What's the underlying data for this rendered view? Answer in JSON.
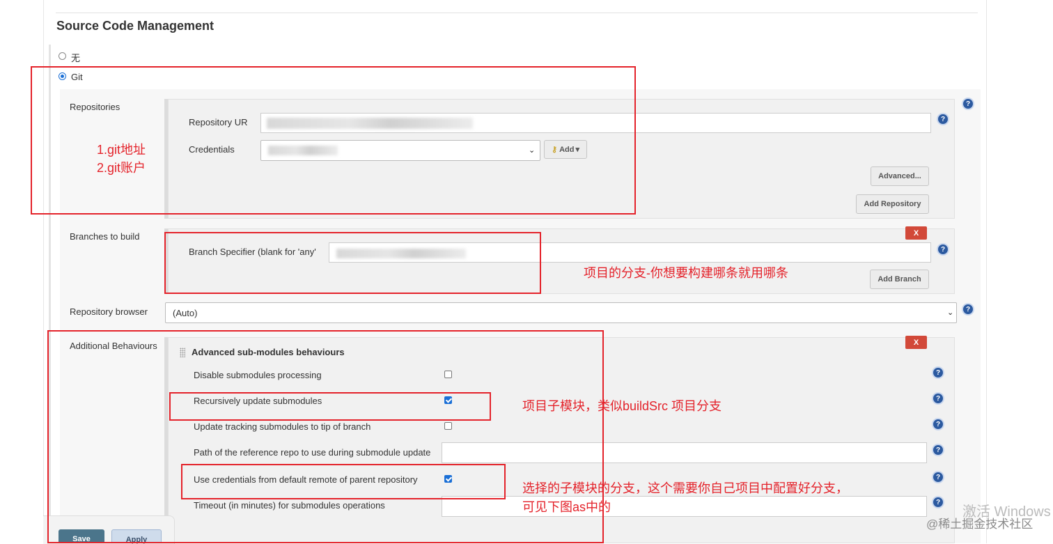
{
  "section": {
    "title": "Source Code Management"
  },
  "scm": {
    "none_label": "无",
    "git_label": "Git",
    "selected": "Git"
  },
  "repositories": {
    "label": "Repositories",
    "repo_url_label": "Repository UR",
    "credentials_label": "Credentials",
    "add_label": "Add",
    "advanced_label": "Advanced...",
    "add_repository_label": "Add Repository"
  },
  "branches": {
    "label": "Branches to build",
    "specifier_label": "Branch Specifier (blank for 'any'",
    "add_branch_label": "Add Branch",
    "delete_label": "X"
  },
  "browser": {
    "label": "Repository browser",
    "value": "(Auto)"
  },
  "behaviours": {
    "label": "Additional Behaviours",
    "group_title": "Advanced sub-modules behaviours",
    "delete_label": "X",
    "items": [
      {
        "label": "Disable submodules processing",
        "checked": false
      },
      {
        "label": "Recursively update submodules",
        "checked": true
      },
      {
        "label": "Update tracking submodules to tip of branch",
        "checked": false
      },
      {
        "label": "Path of the reference repo to use during submodule update"
      },
      {
        "label": "Use credentials from default remote of parent repository",
        "checked": true
      },
      {
        "label": "Timeout (in minutes) for submodules operations"
      }
    ]
  },
  "annotations": {
    "repo_note_line1": "1.git地址",
    "repo_note_line2": "2.git账户",
    "branch_note": "项目的分支-你想要构建哪条就用哪条",
    "recursive_note": "项目子模块，类似buildSrc 项目分支",
    "credentials_note_line1": "选择的子模块的分支，这个需要你自己项目中配置好分支，",
    "credentials_note_line2": "可见下图as中的"
  },
  "footer": {
    "save_label": "Save",
    "apply_label": "Apply"
  },
  "watermark": {
    "windows_text": "激活 Windows",
    "community_text": "@稀土掘金技术社区"
  },
  "colors": {
    "annotation_red": "#e4222a",
    "help_blue": "#2c5aa0",
    "delete_red": "#d24939"
  }
}
